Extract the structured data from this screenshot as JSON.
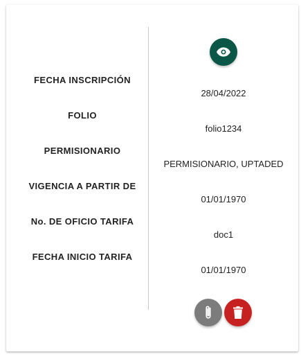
{
  "colors": {
    "view_button": "#0b5747",
    "attach_button": "#7c7c7c",
    "delete_button": "#c62222"
  },
  "icons": {
    "view": "eye-icon",
    "attach": "paperclip-icon",
    "delete": "trash-icon"
  },
  "fields": [
    {
      "label": "FECHA INSCRIPCIÓN",
      "value": "28/04/2022"
    },
    {
      "label": "FOLIO",
      "value": "folio1234"
    },
    {
      "label": "PERMISIONARIO",
      "value": "PERMISIONARIO, UPTADED"
    },
    {
      "label": "VIGENCIA A PARTIR DE",
      "value": "01/01/1970"
    },
    {
      "label": "No. DE OFICIO TARIFA",
      "value": "doc1"
    },
    {
      "label": "FECHA INICIO TARIFA",
      "value": "01/01/1970"
    }
  ]
}
